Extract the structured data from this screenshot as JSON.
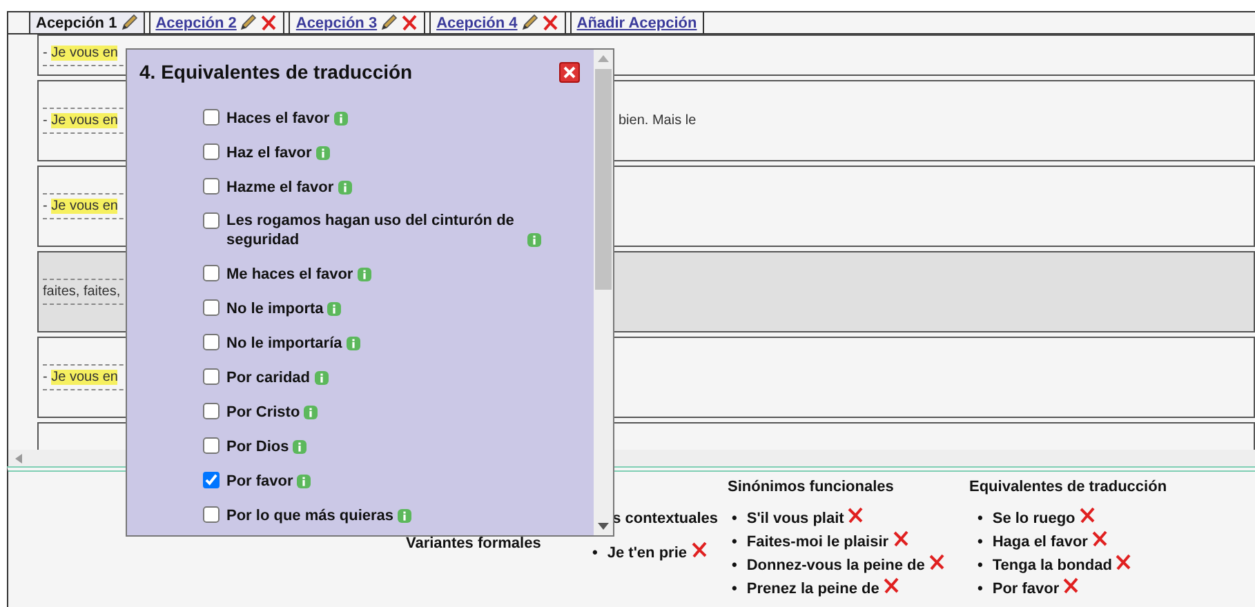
{
  "tabs": [
    {
      "label": "Acepción 1",
      "selected": true,
      "deletable": false
    },
    {
      "label": "Acepción 2",
      "selected": false,
      "deletable": true
    },
    {
      "label": "Acepción 3",
      "selected": false,
      "deletable": true
    },
    {
      "label": "Acepción 4",
      "selected": false,
      "deletable": true
    }
  ],
  "add_tab": "Añadir Acepción",
  "examples": [
    {
      "prefix": "- ",
      "highlight": "Je vous en",
      "shaded": false
    },
    {
      "prefix": "- ",
      "highlight": "Je vous en",
      "tail": "bien. Mais le",
      "shaded": false
    },
    {
      "prefix": "- ",
      "highlight": "Je vous en",
      "shaded": false
    },
    {
      "prefix": "faites, faites,",
      "shaded": true
    },
    {
      "prefix": "- ",
      "highlight": "Je vous en",
      "shaded": false
    }
  ],
  "dialog": {
    "title": "4. Equivalentes de traducción",
    "options": [
      {
        "label": "Haces el favor",
        "checked": false
      },
      {
        "label": "Haz el favor",
        "checked": false
      },
      {
        "label": "Hazme el favor",
        "checked": false
      },
      {
        "label": "Les rogamos hagan uso del cinturón de seguridad",
        "checked": false
      },
      {
        "label": "Me haces el favor",
        "checked": false
      },
      {
        "label": "No le importa",
        "checked": false
      },
      {
        "label": "No le importaría",
        "checked": false
      },
      {
        "label": "Por caridad",
        "checked": false
      },
      {
        "label": "Por Cristo",
        "checked": false
      },
      {
        "label": "Por Dios",
        "checked": false
      },
      {
        "label": "Por favor",
        "checked": true
      },
      {
        "label": "Por lo que más quieras",
        "checked": false
      }
    ]
  },
  "columns": [
    {
      "heading": "Variantes formales"
    },
    {
      "heading": "s contextuales",
      "marker": "•",
      "items": [
        "Je t'en prie"
      ]
    },
    {
      "heading": "Sinónimos funcionales",
      "marker": "•",
      "items": [
        "S'il vous plait",
        "Faites-moi le plaisir",
        "Donnez-vous la peine de",
        "Prenez la peine de"
      ]
    },
    {
      "heading": "Equivalentes de traducción",
      "marker": "•",
      "items": [
        "Se lo ruego",
        "Haga el favor",
        "Tenga la bondad",
        "Por favor"
      ]
    }
  ]
}
